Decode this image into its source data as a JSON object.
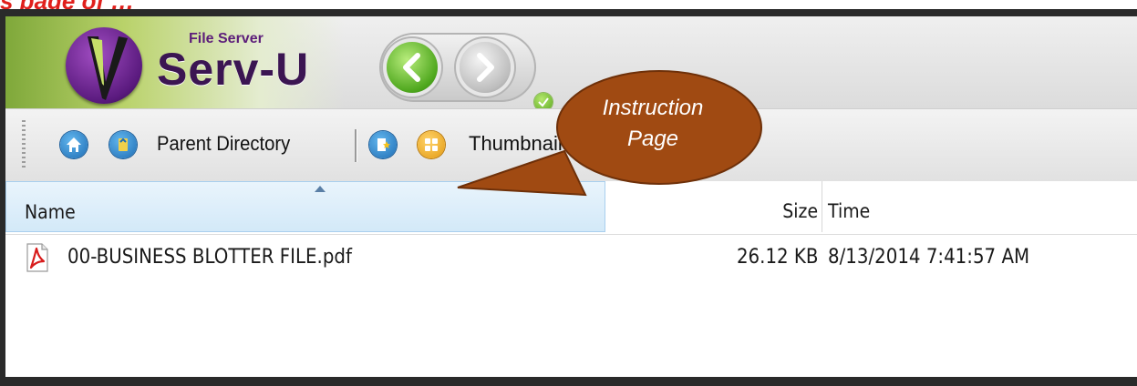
{
  "caption": {
    "text": "s page of …"
  },
  "app": {
    "brand_top": "File Server",
    "brand_name": "Serv-U"
  },
  "toolbar": {
    "parent_label": "Parent Directory",
    "thumbnails_label": "Thumbnails"
  },
  "columns": {
    "name": "Name",
    "size": "Size",
    "time": "Time"
  },
  "files": [
    {
      "name": "00-BUSINESS BLOTTER FILE.pdf",
      "size": "26.12 KB",
      "time": "8/13/2014 7:41:57 AM",
      "icon": "pdf-icon"
    }
  ],
  "callout": {
    "line1": "Instruction",
    "line2": "Page"
  },
  "colors": {
    "callout_fill": "#a04a12",
    "caption": "#e0201c",
    "nav_green": "#4ea71d",
    "brand_purple": "#5a1a7e"
  },
  "icons": [
    "logo-icon",
    "back-arrow-icon",
    "forward-arrow-icon",
    "home-icon",
    "parent-directory-icon",
    "bookmark-icon",
    "thumbnails-icon",
    "sort-ascending-icon",
    "pdf-icon"
  ]
}
